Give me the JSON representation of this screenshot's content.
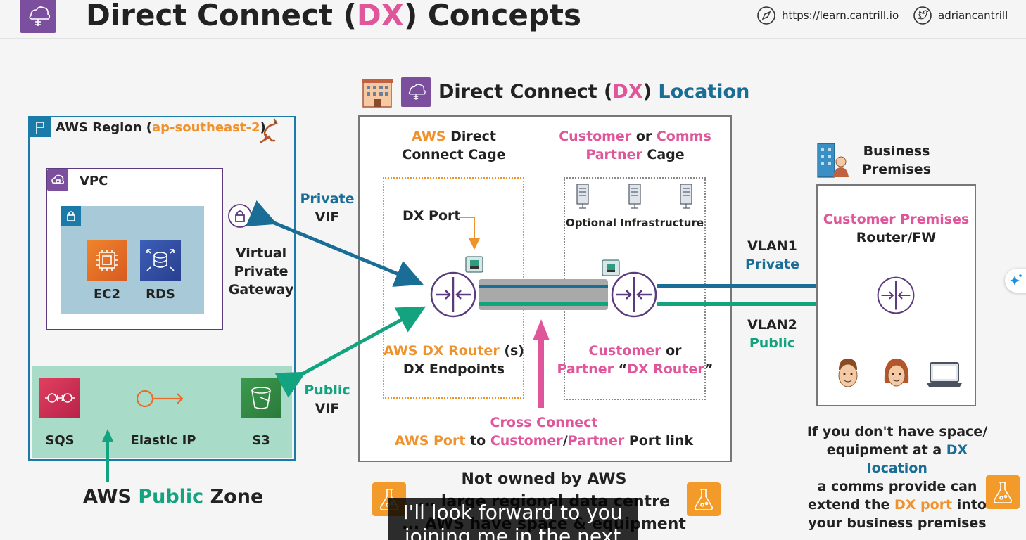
{
  "header": {
    "title_part1": "Direct Connect (",
    "title_dx": "DX",
    "title_part2": ") Concepts",
    "link_url": "https://learn.cantrill.io",
    "twitter_handle": "adriancantrill"
  },
  "location": {
    "title_part1": "Direct Connect (",
    "title_dx": "DX",
    "title_part2": ")",
    "title_location": "Location"
  },
  "region": {
    "label_prefix": "AWS Region (",
    "code": "ap-southeast-2",
    "label_suffix": ")"
  },
  "vpc": {
    "label": "VPC",
    "ec2": "EC2",
    "rds": "RDS"
  },
  "vgw": {
    "line1": "Virtual",
    "line2": "Private",
    "line3": "Gateway"
  },
  "public_zone": {
    "sqs": "SQS",
    "eip": "Elastic IP",
    "s3": "S3",
    "word1": "AWS",
    "word2": "Public",
    "word3": "Zone"
  },
  "vifs": {
    "private_line1": "Private",
    "private_line2": "VIF",
    "public_line1": "Public",
    "public_line2": "VIF"
  },
  "aws_cage": {
    "title_aws": "AWS",
    "title_rest1": " Direct",
    "title_line2": "Connect Cage",
    "dx_port": "DX Port",
    "router_line1_orange": "AWS DX Router",
    "router_line1_rest": " (s)",
    "router_line2": "DX Endpoints"
  },
  "customer_cage": {
    "customer": "Customer",
    "or": " or ",
    "comms": "Comms",
    "partner": "Partner",
    "cage": " Cage",
    "optional": "Optional Infrastructure",
    "router_customer": "Customer",
    "router_or": " or",
    "router_partner": "Partner",
    "router_q1": " “",
    "router_dx": "DX Router",
    "router_q2": "”"
  },
  "cross_connect": {
    "title": "Cross Connect",
    "aws_port": "AWS Port",
    "to": " to ",
    "customer": "Customer",
    "slash": "/",
    "partner": "Partner",
    "rest": " Port link"
  },
  "not_owned": {
    "line1": "Not owned by AWS",
    "line2": "... large regional data centre",
    "line3": "... AWS have space & equipment"
  },
  "vlans": {
    "vlan1": "VLAN1",
    "vlan1_type": "Private",
    "vlan2": "VLAN2",
    "vlan2_type": "Public"
  },
  "business": {
    "line1": "Business",
    "line2": "Premises",
    "premises_title": "Customer Premises",
    "premises_sub": "Router/FW"
  },
  "note": {
    "line1": "If you don't have space/",
    "line2_prefix": "equipment at a ",
    "line2_hl": "DX location",
    "line3": "a comms provide can",
    "line4_prefix": "extend the ",
    "line4_hl": "DX port",
    "line4_suffix": " into",
    "line5": "your business premises"
  },
  "subtitle": {
    "line1": "I'll look forward to you",
    "line2": "joining me in the next"
  },
  "colors": {
    "pink": "#e0569a",
    "orange": "#f0922c",
    "blue": "#1a6e96",
    "green": "#14a37f",
    "purple": "#7b4f9e"
  }
}
